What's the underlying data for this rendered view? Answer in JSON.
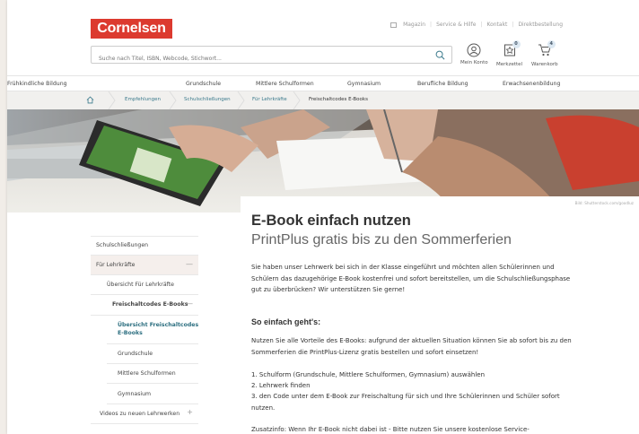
{
  "logo": "Cornelsen",
  "toplinks": [
    "Magazin",
    "Service & Hilfe",
    "Kontakt",
    "Direktbestellung"
  ],
  "search": {
    "placeholder": "Suche nach Titel, ISBN, Webcode, Stichwort..."
  },
  "account": [
    {
      "label": "Mein Konto",
      "badge": ""
    },
    {
      "label": "Merkzettel",
      "badge": "0"
    },
    {
      "label": "Warenkorb",
      "badge": "4"
    }
  ],
  "mainnav": [
    "Frühkindliche Bildung",
    "Grundschule",
    "Mittlere Schulformen",
    "Gymnasium",
    "Berufliche Bildung",
    "Erwachsenenbildung"
  ],
  "breadcrumb": [
    "Empfehlungen",
    "Schulschließungen",
    "Für Lehrkräfte",
    "Freischaltcodes E-Books"
  ],
  "hero_caption": "Bild: Shutterstock.com/goodluz",
  "article": {
    "title": "E-Book einfach nutzen",
    "subtitle": "PrintPlus gratis bis zu den Sommerferien",
    "intro": "Sie haben unser Lehrwerk bei sich in der Klasse eingeführt und möchten allen Schülerinnen und Schülern das dazugehörige E-Book kostenfrei und sofort bereitstellen, um die Schulschließungsphase gut zu überbrücken? Wir unterstützen Sie gerne!",
    "heading": "So einfach geht's:",
    "p1": "Nutzen Sie alle Vorteile des E-Books: aufgrund der aktuellen Situation können Sie ab sofort bis zu den Sommerferien die PrintPlus-Lizenz  gratis bestellen und sofort einsetzen!",
    "steps": [
      "1. Schulform (Grundschule, Mittlere Schulformen, Gymnasium) auswählen",
      "2. Lehrwerk finden",
      "3. den Code unter dem E-Book zur Freischaltung für sich und Ihre Schülerinnen und Schüler sofort nutzen."
    ],
    "extra": "Zusatzinfo: Wenn Ihr E-Book nicht dabei ist - Bitte nutzen Sie unsere kostenlose Service-"
  },
  "sidebar": [
    {
      "label": "Schulschließungen",
      "toggle": ""
    },
    {
      "label": "Für Lehrkräfte",
      "toggle": "—"
    },
    {
      "label": "Übersicht Für Lehrkräfte",
      "toggle": ""
    },
    {
      "label": "Freischaltcodes E-Books",
      "toggle": "—"
    },
    {
      "label": "Übersicht Freischaltcodes E-Books",
      "toggle": ""
    },
    {
      "label": "Grundschule",
      "toggle": ""
    },
    {
      "label": "Mittlere Schulformen",
      "toggle": ""
    },
    {
      "label": "Gymnasium",
      "toggle": ""
    },
    {
      "label": "Videos zu neuen Lehrwerken",
      "toggle": "+"
    }
  ],
  "colors": {
    "brand": "#dc3a2f",
    "link": "#3b7a8c",
    "active_bg": "#f5efec"
  }
}
